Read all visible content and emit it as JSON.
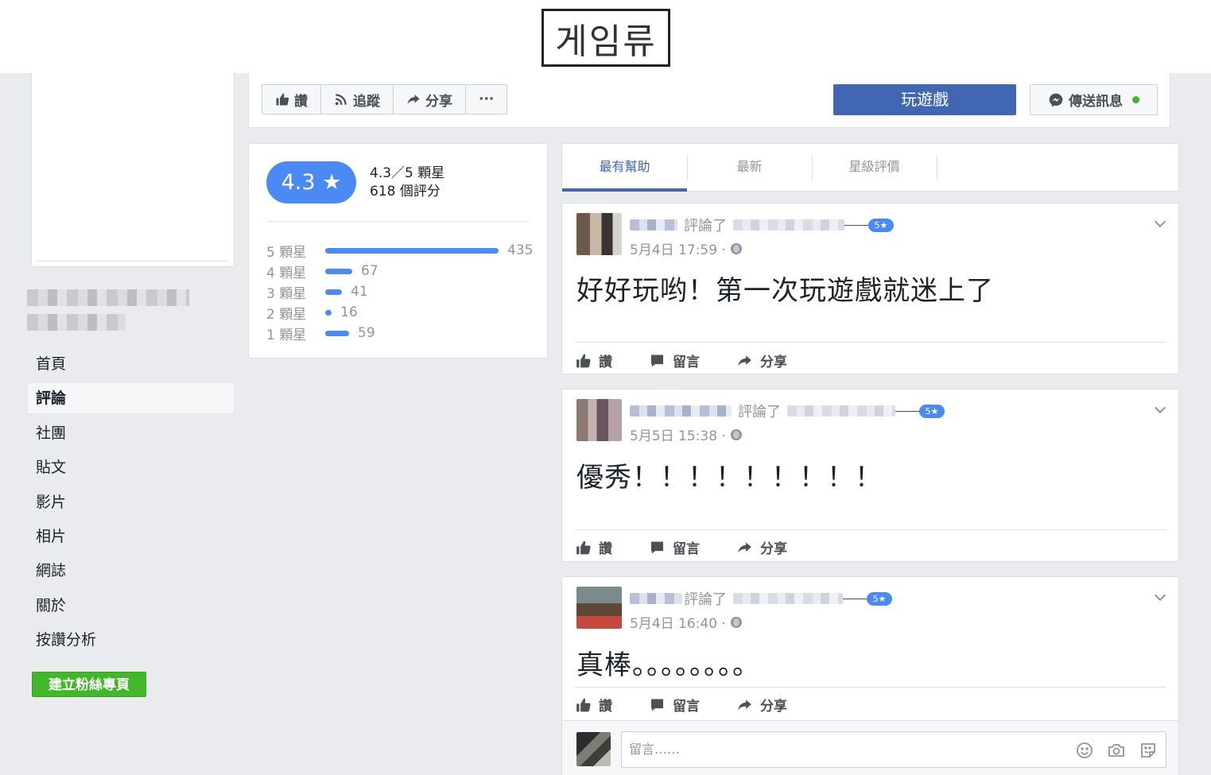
{
  "watermark": "게임류",
  "toolbar": {
    "like": "讚",
    "follow": "追蹤",
    "share": "分享",
    "more": "···",
    "play": "玩遊戲",
    "message": "傳送訊息"
  },
  "sidebar": {
    "items": [
      {
        "label": "首頁"
      },
      {
        "label": "評論"
      },
      {
        "label": "社團"
      },
      {
        "label": "貼文"
      },
      {
        "label": "影片"
      },
      {
        "label": "相片"
      },
      {
        "label": "網誌"
      },
      {
        "label": "關於"
      },
      {
        "label": "按讚分析"
      }
    ],
    "create_page": "建立粉絲專頁"
  },
  "rating": {
    "score": "4.3 ★",
    "summary_line1": "4.3／5 顆星",
    "summary_line2": "618 個評分",
    "distribution": [
      {
        "label": "5 顆星",
        "count": "435",
        "value": 435
      },
      {
        "label": "4 顆星",
        "count": "67",
        "value": 67
      },
      {
        "label": "3 顆星",
        "count": "41",
        "value": 41
      },
      {
        "label": "2 顆星",
        "count": "16",
        "value": 16
      },
      {
        "label": "1 顆星",
        "count": "59",
        "value": 59
      }
    ]
  },
  "tabs": [
    "最有幫助",
    "最新",
    "星級評價"
  ],
  "reviews": [
    {
      "verb": "評論了",
      "stars": "5★",
      "time": "5月4日 17:59 ·",
      "text": "好好玩哟！第一次玩遊戲就迷上了"
    },
    {
      "verb": "評論了",
      "stars": "5★",
      "time": "5月5日 15:38 ·",
      "text": "優秀！！！！！！！！！"
    },
    {
      "verb": "評論了",
      "stars": "5★",
      "time": "5月4日 16:40 ·",
      "text": "真棒。。。。。。。。"
    }
  ],
  "review_actions": {
    "like": "讚",
    "comment": "留言",
    "share": "分享"
  },
  "comment": {
    "placeholder": "留言……"
  }
}
